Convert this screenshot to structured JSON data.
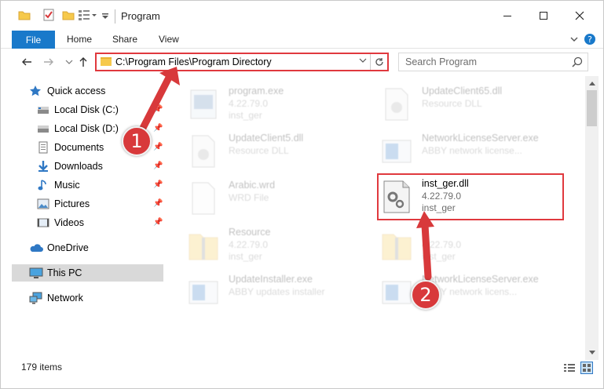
{
  "window": {
    "title": "Program",
    "controls": {
      "minimize": "─",
      "maximize": "☐",
      "close": "✕"
    }
  },
  "ribbon": {
    "tabs": [
      {
        "label": "File",
        "active": true
      },
      {
        "label": "Home"
      },
      {
        "label": "Share"
      },
      {
        "label": "View"
      }
    ]
  },
  "address": {
    "path": "C:\\Program Files\\Program Directory",
    "search_placeholder": "Search Program"
  },
  "sidebar": {
    "items": [
      {
        "label": "Quick access",
        "icon": "star-icon"
      },
      {
        "label": "Local Disk (C:)",
        "icon": "drive-icon",
        "pinned": true
      },
      {
        "label": "Local Disk (D:)",
        "icon": "drive-icon",
        "pinned": true
      },
      {
        "label": "Documents",
        "icon": "documents-icon",
        "pinned": true
      },
      {
        "label": "Downloads",
        "icon": "download-icon",
        "pinned": true
      },
      {
        "label": "Music",
        "icon": "music-icon",
        "pinned": true
      },
      {
        "label": "Pictures",
        "icon": "pictures-icon",
        "pinned": true
      },
      {
        "label": "Videos",
        "icon": "videos-icon",
        "pinned": true
      },
      {
        "label": "OneDrive",
        "icon": "cloud-icon"
      },
      {
        "label": "This PC",
        "icon": "computer-icon",
        "selected": true
      },
      {
        "label": "Network",
        "icon": "network-icon"
      }
    ]
  },
  "files": [
    {
      "name": "program.exe",
      "line2": "4.22.79.0",
      "line3": "inst_ger",
      "icon": "exe-icon"
    },
    {
      "name": "UpdateClient65.dll",
      "line2": "Resource DLL",
      "line3": "",
      "icon": "dll-icon"
    },
    {
      "name": "UpdateClient5.dll",
      "line2": "Resource DLL",
      "line3": "",
      "icon": "dll-icon"
    },
    {
      "name": "NetworkLicenseServer.exe",
      "line2": "ABBY network license...",
      "line3": "",
      "icon": "app-icon"
    },
    {
      "name": "Arabic.wrd",
      "line2": "WRD File",
      "line3": "",
      "icon": "file-icon"
    },
    {
      "name": "inst_ger.dll",
      "line2": "4.22.79.0",
      "line3": "inst_ger",
      "icon": "dll-gear-icon"
    },
    {
      "name": "Resource",
      "line2": "4.22.79.0",
      "line3": "inst_ger",
      "icon": "folder-zip-icon"
    },
    {
      "name": "",
      "line2": "4.22.79.0",
      "line3": "inst_ger",
      "icon": "folder-zip-icon"
    },
    {
      "name": "UpdateInstaller.exe",
      "line2": "ABBY updates installer",
      "line3": "",
      "icon": "app-icon"
    },
    {
      "name": "NetworkLicenseServer.exe",
      "line2": "ABBY network licens...",
      "line3": "",
      "icon": "app-icon"
    }
  ],
  "status": {
    "items_count": "179 items"
  },
  "annotations": {
    "step1": "1",
    "step2": "2"
  },
  "colors": {
    "accent": "#1979ca",
    "highlight": "#e0393e",
    "badge": "#d8393b"
  }
}
